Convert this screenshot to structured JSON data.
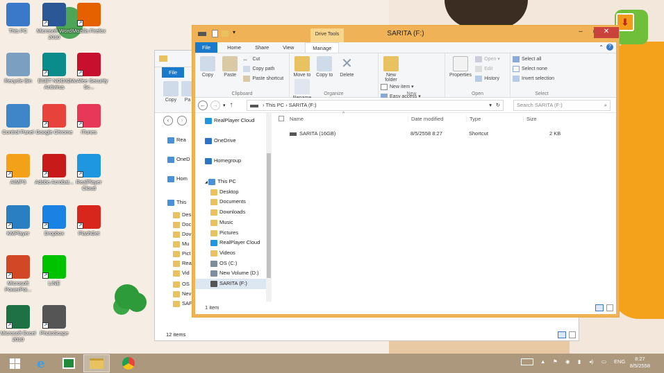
{
  "desktop": {
    "icons": [
      {
        "label": "This PC",
        "icon": "this-pc-icon",
        "color": "#3a78c9"
      },
      {
        "label": "Microsoft Word 2010",
        "icon": "word-icon",
        "color": "#2b5797"
      },
      {
        "label": "Mozilla Firefox",
        "icon": "firefox-icon",
        "color": "#e66000"
      },
      {
        "label": "Recycle Bin",
        "icon": "recycle-bin-icon",
        "color": "#7a9fc0"
      },
      {
        "label": "ESET NOD32 Antivirus",
        "icon": "eset-icon",
        "color": "#0b8c8c"
      },
      {
        "label": "McAfee Security Sc...",
        "icon": "mcafee-icon",
        "color": "#c8102e"
      },
      {
        "label": "Control Panel",
        "icon": "control-panel-icon",
        "color": "#3f86c8"
      },
      {
        "label": "Google Chrome",
        "icon": "chrome-icon",
        "color": "#e8433a"
      },
      {
        "label": "iTunes",
        "icon": "itunes-icon",
        "color": "#e8385a"
      },
      {
        "label": "AIMP3",
        "icon": "aimp-icon",
        "color": "#f4a11a"
      },
      {
        "label": "Adobe Acrobat...",
        "icon": "acrobat-icon",
        "color": "#c91a1a"
      },
      {
        "label": "RealPlayer Cloud",
        "icon": "realplayer-cloud-icon",
        "color": "#1f97e0"
      },
      {
        "label": "KMPlayer",
        "icon": "kmplayer-icon",
        "color": "#2a7ec2"
      },
      {
        "label": "Dropbox",
        "icon": "dropbox-icon",
        "color": "#1a82e2"
      },
      {
        "label": "FlashGet",
        "icon": "flashget-icon",
        "color": "#d9261c"
      },
      {
        "label": "Microsoft PowerPoi...",
        "icon": "powerpoint-icon",
        "color": "#d24726"
      },
      {
        "label": "LINE",
        "icon": "line-icon",
        "color": "#00c300"
      },
      {
        "label": "Microsoft Excel 2010",
        "icon": "excel-icon",
        "color": "#1e7145"
      },
      {
        "label": "PhotoScape",
        "icon": "photoscape-icon",
        "color": "#555555"
      }
    ]
  },
  "back_window": {
    "tab_file": "File",
    "buttons": [
      "Copy",
      "Pa"
    ],
    "nav": [
      "Rea",
      "OneD",
      "Hom",
      "This",
      "Des",
      "Doc",
      "Dov",
      "Mu",
      "Pict",
      "Rea",
      "Vid",
      "OS",
      "Nev",
      "SAF"
    ],
    "status": "12 items"
  },
  "window": {
    "title": "SARITA (F:)",
    "context_tab": "Drive Tools",
    "tabs": {
      "file": "File",
      "home": "Home",
      "share": "Share",
      "view": "View",
      "manage": "Manage"
    },
    "ribbon": {
      "clipboard": {
        "copy": "Copy",
        "paste": "Paste",
        "cut": "Cut",
        "copy_path": "Copy path",
        "paste_shortcut": "Paste shortcut",
        "label": "Clipboard"
      },
      "organize": {
        "move_to": "Move to",
        "copy_to": "Copy to",
        "delete": "Delete",
        "rename": "Rename",
        "label": "Organize"
      },
      "new": {
        "new_folder": "New folder",
        "new_item": "New item",
        "easy_access": "Easy access",
        "label": "New"
      },
      "open": {
        "properties": "Properties",
        "open": "Open",
        "edit": "Edit",
        "history": "History",
        "label": "Open"
      },
      "select": {
        "select_all": "Select all",
        "select_none": "Select none",
        "invert": "Invert selection",
        "label": "Select"
      }
    },
    "address": {
      "this_pc": "This PC",
      "drive": "SARITA (F:)"
    },
    "search_placeholder": "Search SARITA (F:)",
    "nav": [
      {
        "label": "RealPlayer Cloud",
        "icon": "realplayer-cloud-icon",
        "color": "#1f97e0",
        "indent": 0
      },
      {
        "label": "OneDrive",
        "icon": "onedrive-icon",
        "color": "#2d72c4",
        "indent": 0
      },
      {
        "label": "Homegroup",
        "icon": "homegroup-icon",
        "color": "#2a78c2",
        "indent": 0
      },
      {
        "label": "This PC",
        "icon": "this-pc-icon",
        "color": "#4a90d9",
        "indent": 0
      },
      {
        "label": "Desktop",
        "icon": "folder-icon",
        "color": "#e8c160",
        "indent": 1
      },
      {
        "label": "Documents",
        "icon": "folder-icon",
        "color": "#e8c160",
        "indent": 1
      },
      {
        "label": "Downloads",
        "icon": "folder-icon",
        "color": "#e8c160",
        "indent": 1
      },
      {
        "label": "Music",
        "icon": "folder-icon",
        "color": "#e8c160",
        "indent": 1
      },
      {
        "label": "Pictures",
        "icon": "folder-icon",
        "color": "#e8c160",
        "indent": 1
      },
      {
        "label": "RealPlayer Cloud",
        "icon": "realplayer-cloud-icon",
        "color": "#1f97e0",
        "indent": 1
      },
      {
        "label": "Videos",
        "icon": "folder-icon",
        "color": "#e8c160",
        "indent": 1
      },
      {
        "label": "OS (C:)",
        "icon": "drive-icon",
        "color": "#7c8da0",
        "indent": 1
      },
      {
        "label": "New Volume (D:)",
        "icon": "drive-icon",
        "color": "#7c8da0",
        "indent": 1
      },
      {
        "label": "SARITA (F:)",
        "icon": "usb-drive-icon",
        "color": "#555555",
        "indent": 1
      }
    ],
    "columns": {
      "name": "Name",
      "date": "Date modified",
      "type": "Type",
      "size": "Size"
    },
    "files": [
      {
        "name": "SARITA (16GB)",
        "date": "8/5/2558 8:27",
        "type": "Shortcut",
        "size": "2 KB"
      }
    ],
    "status": "1 item"
  },
  "taskbar": {
    "lang": "ENG",
    "time": "8:27",
    "date": "8/5/2558"
  },
  "colors": {
    "accent": "#1979ca",
    "frame": "#f0b257",
    "taskbar": "#a08c6e"
  }
}
